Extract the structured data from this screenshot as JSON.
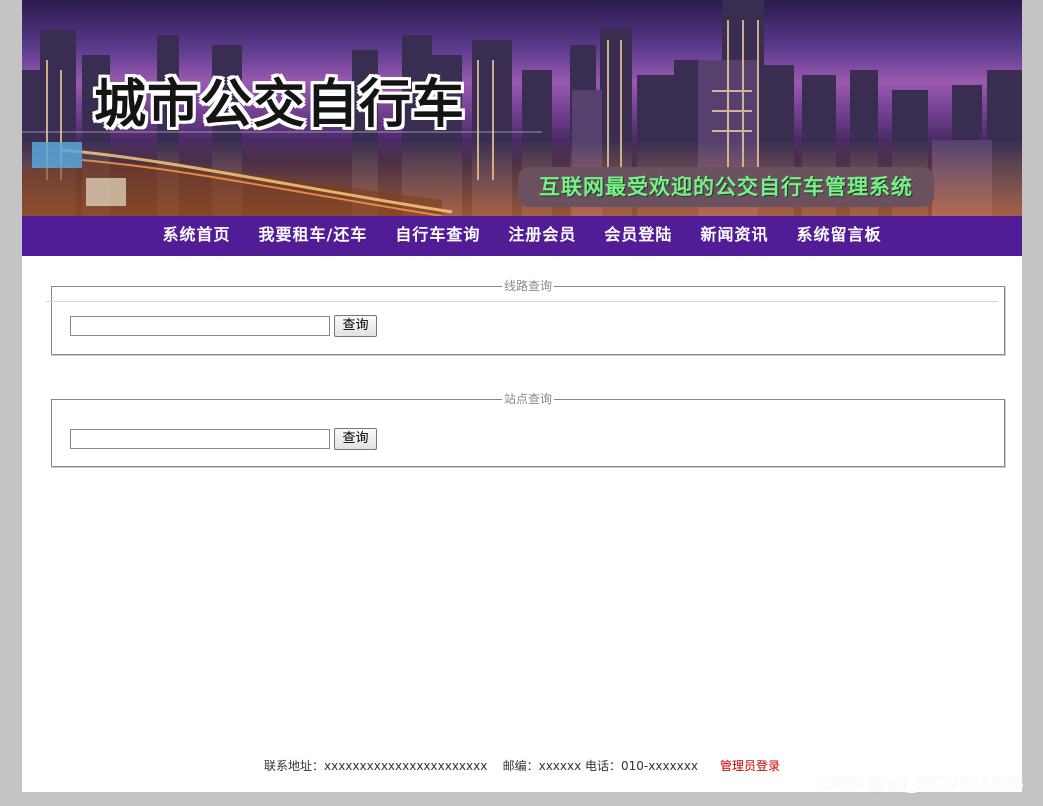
{
  "banner": {
    "title": "城市公交自行车",
    "slogan": "互联网最受欢迎的公交自行车管理系统"
  },
  "nav": {
    "items": [
      "系统首页",
      "我要租车/还车",
      "自行车查询",
      "注册会员",
      "会员登陆",
      "新闻资讯",
      "系统留言板"
    ]
  },
  "route_search": {
    "legend": "线路查询",
    "input_value": "",
    "button_label": "查询"
  },
  "station_search": {
    "legend": "站点查询",
    "input_value": "",
    "button_label": "查询"
  },
  "footer": {
    "text": "联系地址：xxxxxxxxxxxxxxxxxxxxxxx    邮编：xxxxxx 电话：010-xxxxxxx",
    "admin_link": "管理员登录"
  },
  "watermark": "CSDN @qq_3072911638",
  "colors": {
    "nav_bg": "#511d96",
    "page_bg": "#c4c4c4",
    "slogan_text": "#7af08a",
    "admin_link": "#cc0000"
  }
}
